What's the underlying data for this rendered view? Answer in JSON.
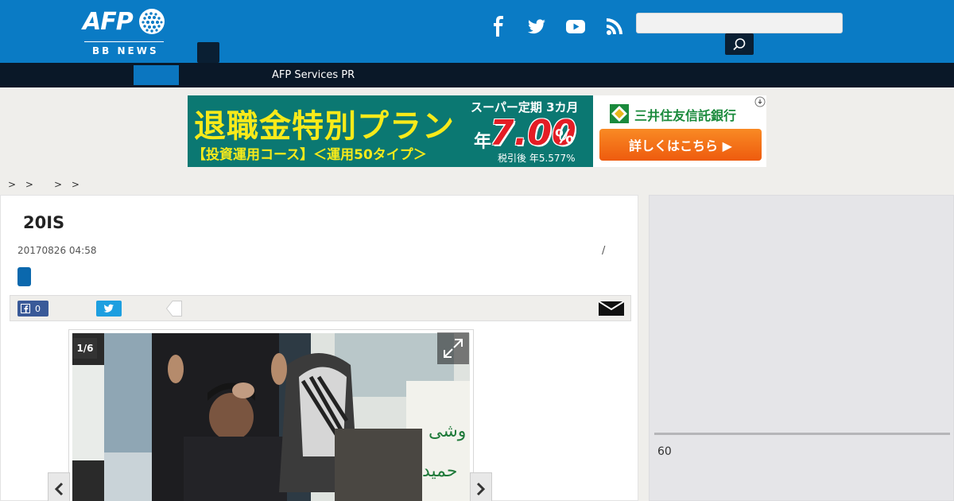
{
  "header": {
    "logo_text": "AFP",
    "logo_subtext": "BB NEWS",
    "social": [
      "facebook-icon",
      "twitter-icon",
      "youtube-icon",
      "rss-icon"
    ],
    "search_placeholder": "",
    "colors": {
      "header_bg": "#0a7bc5",
      "nav_bg": "#0a1828",
      "accent": "#0b76c0"
    }
  },
  "nav": {
    "items": [
      {
        "label": ""
      },
      {
        "label": "AFP Services PR"
      }
    ]
  },
  "ad": {
    "headline": "退職金特別プラン",
    "subline": "【投資運用コース】＜運用50タイプ＞",
    "super": "スーパー定期 3カ月",
    "year": "年",
    "rate": "7.00",
    "percent": "%",
    "after_tax": "税引後 年5.577%",
    "bank": "三井住友信託銀行",
    "cta": "詳しくはこちら ▶"
  },
  "breadcrumb": [
    ">  >",
    ">  >"
  ],
  "article": {
    "title": "20IS",
    "date": "20170826 04:58",
    "slash": "/",
    "share": {
      "facebook_count": "0"
    }
  },
  "slider": {
    "counter": "1/6",
    "current": 1,
    "total": 6
  },
  "sidebar": {
    "count": "60"
  }
}
